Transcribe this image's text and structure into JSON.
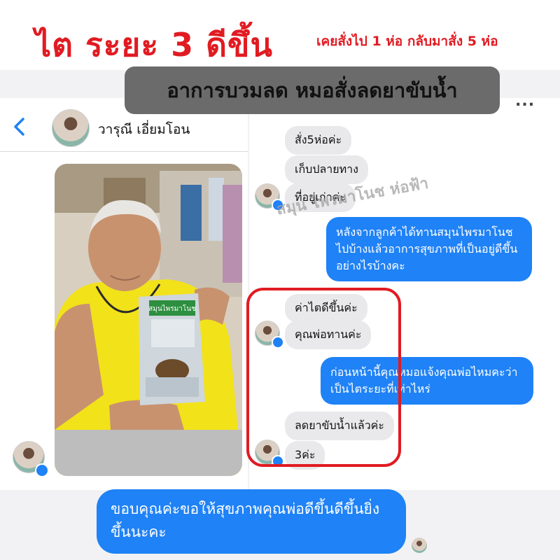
{
  "headline": {
    "big": "ไต ระยะ 3 ดีขึ้น",
    "small": "เคยสั่งไป 1 ห่อ กลับมาสั่ง 5 ห่อ"
  },
  "banner": "อาการบวมลด หมอสั่งลดยาขับน้ำ",
  "chat": {
    "contact_name": "วารุณี เอี่ยมโอน",
    "more_label": "...",
    "watermark": "สมุน ไพรมาโนช ห่อฟ้า",
    "incoming": [
      "สั่ง5ห่อค่ะ",
      "เก็บปลายทาง",
      "ที่อยู่เก่าค่ะ",
      "ค่าไตดีขึ้นค่ะ",
      "คุณพ่อทานค่ะ",
      "ลดยาขับน้ำแล้วค่ะ",
      "3ค่ะ"
    ],
    "outgoing": [
      "หลังจากลูกค้าได้ทานสมุนไพรมาโนชไปบ้างแล้วอาการสุขภาพที่เป็นอยู่ดีขึ้นอย่างไรบ้างคะ",
      "ก่อนหน้านี้คุณหมอแจ้งคุณพ่อไหมคะว่าเป็นไตระยะที่เท่าไหร่",
      "ขอบคุณค่ะขอให้สุขภาพคุณพ่อดีขึ้นดีขึ้นยิ่งขึ้นนะคะ"
    ]
  },
  "photo": {
    "package_label": "สมุนไพรมาโนช"
  },
  "colors": {
    "accent_red": "#e11b22",
    "bubble_blue": "#1f82f6",
    "bubble_gray": "#e9e9eb"
  }
}
